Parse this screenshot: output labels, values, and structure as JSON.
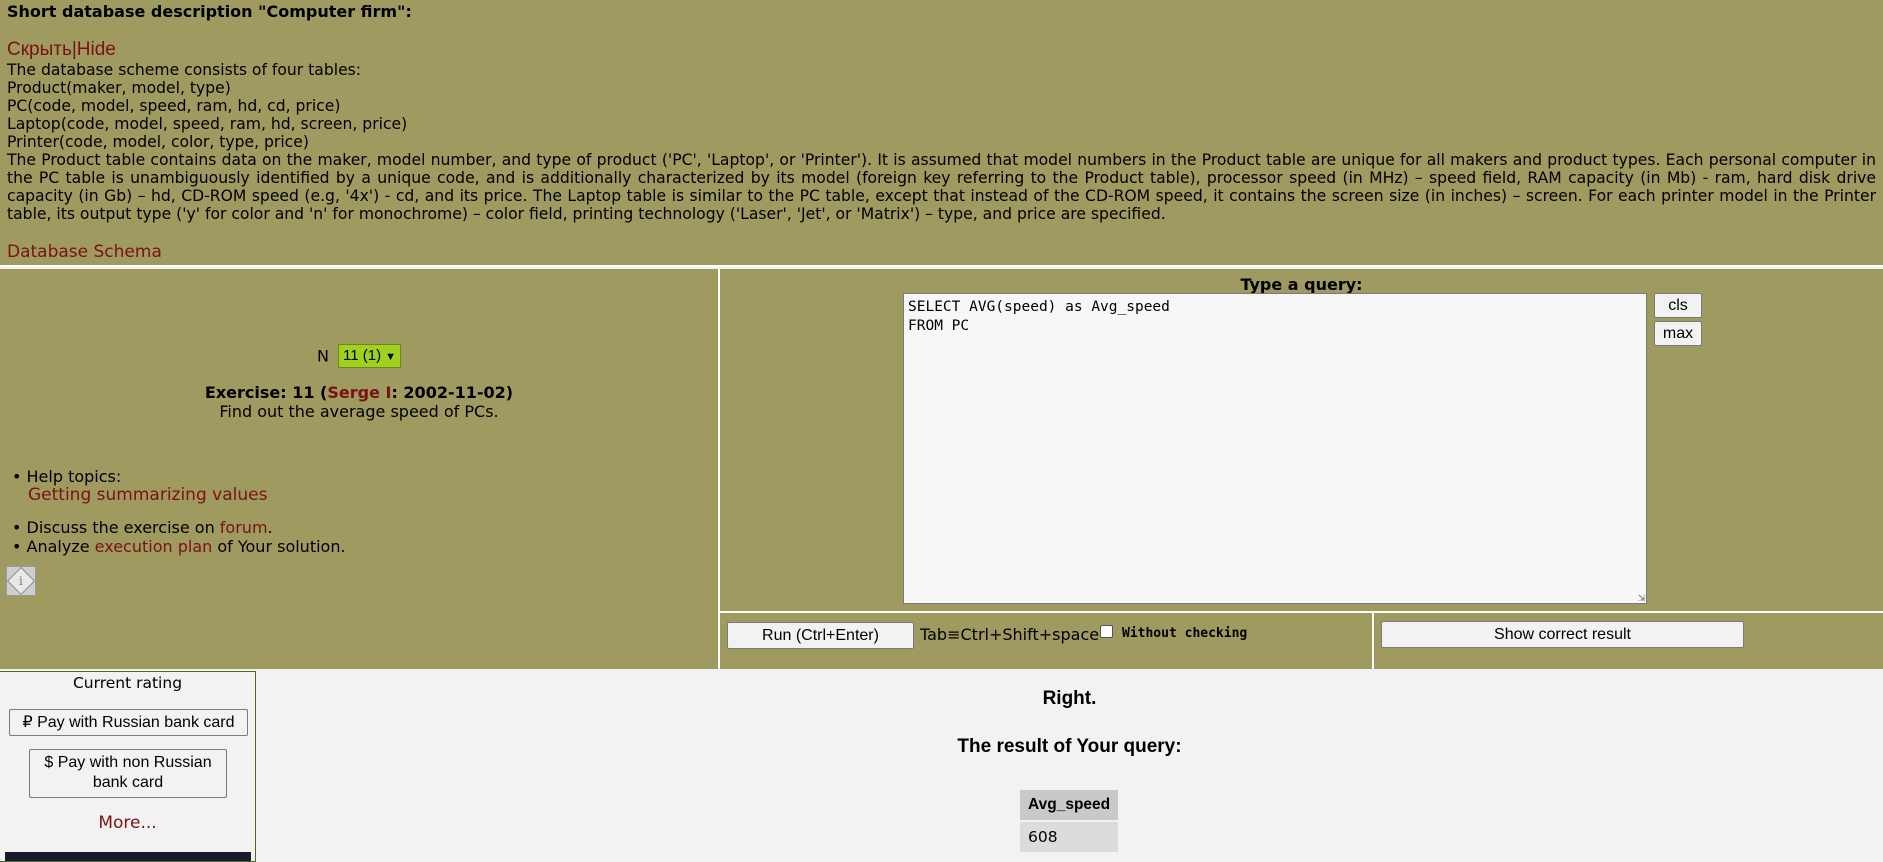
{
  "description": {
    "heading": "Short database description \"Computer firm\":",
    "hide_ru": "Скрыть",
    "hide_sep": "|",
    "hide_en": "Hide",
    "scheme_intro": "The database scheme consists of four tables:",
    "tables": [
      "Product(maker, model, type)",
      "PC(code, model, speed, ram, hd, cd, price)",
      "Laptop(code, model, speed, ram, hd, screen, price)",
      "Printer(code, model, color, type, price)"
    ],
    "paragraph": "The Product table contains data on the maker, model number, and type of product ('PC', 'Laptop', or 'Printer'). It is assumed that model numbers in the Product table are unique for all makers and product types. Each personal computer in the PC table is unambiguously identified by a unique code, and is additionally characterized by its model (foreign key referring to the Product table), processor speed (in MHz) – speed field, RAM capacity (in Mb) - ram, hard disk drive capacity (in Gb) – hd, CD-ROM speed (e.g, '4x') - cd, and its price. The Laptop table is similar to the PC table, except that instead of the CD-ROM speed, it contains the screen size (in inches) – screen. For each printer model in the Printer table, its output type ('y' for color and 'n' for monochrome) – color field, printing technology ('Laser', 'Jet', or 'Matrix') – type, and price are specified.",
    "schema_link": "Database Schema"
  },
  "exercise": {
    "n_label": "N",
    "selected": "11 (1)",
    "title_prefix": "Exercise: 11 (",
    "author": "Serge I",
    "title_suffix": ": 2002-11-02)",
    "task": "Find out the average speed of PCs.",
    "help_label": "• Help topics:",
    "help_link": "Getting summarizing values",
    "discuss_prefix": "• Discuss the exercise on ",
    "discuss_link": "forum",
    "discuss_suffix": ".",
    "analyze_prefix": "• Analyze ",
    "analyze_link": "execution plan",
    "analyze_suffix": " of Your solution.",
    "info_icon_glyph": "i"
  },
  "query": {
    "title": "Type a query:",
    "text": "SELECT AVG(speed) as Avg_speed\nFROM PC",
    "cls_label": "cls",
    "max_label": "max",
    "run_label": "Run (Ctrl+Enter)",
    "tab_hint": "Tab≡Ctrl+Shift+space",
    "without_checking": "Without checking",
    "show_correct": "Show correct result"
  },
  "rating": {
    "title": "Current rating",
    "pay_ru": "₽ Pay with Russian bank card",
    "pay_non_ru": "$ Pay with non Russian bank card",
    "more": "More..."
  },
  "result": {
    "status": "Right.",
    "title": "The result of Your query:",
    "columns": [
      "Avg_speed"
    ],
    "rows": [
      [
        "608"
      ]
    ]
  },
  "colors": {
    "panel_bg": "#9f9a60",
    "link": "#7b1212",
    "select_bg": "#a0d020",
    "page_bg": "#f2f2f2"
  }
}
